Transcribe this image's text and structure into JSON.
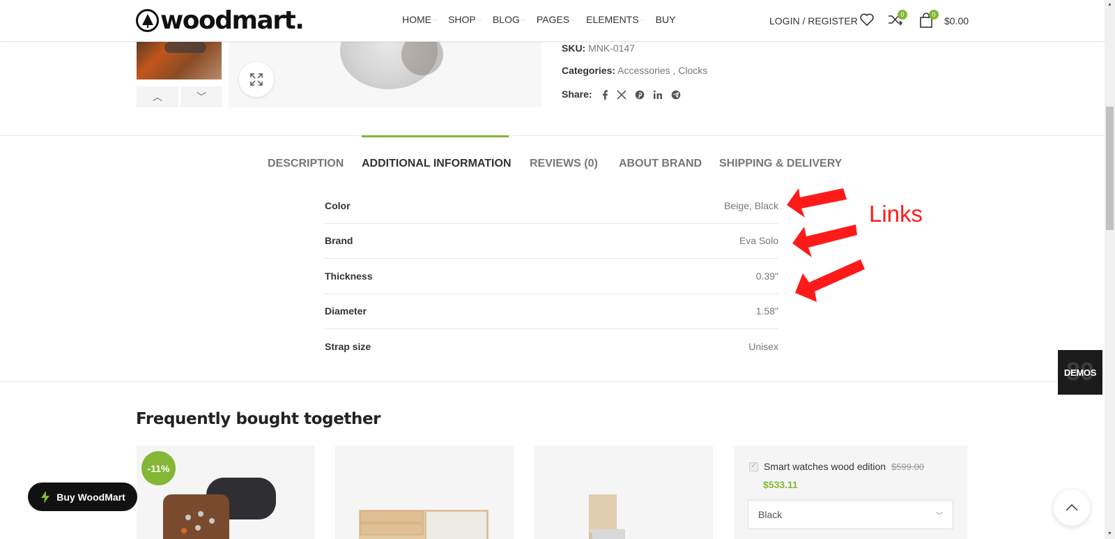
{
  "header": {
    "logo_text": "woodmart.",
    "nav": [
      "HOME",
      "SHOP",
      "BLOG",
      "PAGES",
      "ELEMENTS",
      "BUY"
    ],
    "login": "LOGIN / REGISTER",
    "compare_count": "0",
    "cart_count": "0",
    "cart_total": "$0.00"
  },
  "product": {
    "sku_label": "SKU:",
    "sku": "MNK-0147",
    "categories_label": "Categories:",
    "categories": [
      "Accessories",
      "Clocks"
    ],
    "share_label": "Share:",
    "share_icons": [
      "facebook-icon",
      "x-icon",
      "pinterest-icon",
      "linkedin-icon",
      "telegram-icon"
    ]
  },
  "tabs": [
    "DESCRIPTION",
    "ADDITIONAL INFORMATION",
    "REVIEWS (0)",
    "ABOUT BRAND",
    "SHIPPING & DELIVERY"
  ],
  "active_tab": "ADDITIONAL INFORMATION",
  "attributes": [
    {
      "label": "Color",
      "value": "Beige, Black"
    },
    {
      "label": "Brand",
      "value": "Eva Solo"
    },
    {
      "label": "Thickness",
      "value": "0.39\""
    },
    {
      "label": "Diameter",
      "value": "1.58\""
    },
    {
      "label": "Strap size",
      "value": "Unisex"
    }
  ],
  "annotation": {
    "text": "Links",
    "color": "#ff1a1a"
  },
  "demos_label": "DEMOS",
  "fbt": {
    "title": "Frequently bought together",
    "badge": "-11%",
    "item_name": "Smart watches wood edition",
    "old_price": "$599.00",
    "new_price": "$533.11",
    "select_value": "Black"
  },
  "buy_button": "Buy WoodMart",
  "colors": {
    "accent": "#83b735",
    "dark": "#111111"
  }
}
